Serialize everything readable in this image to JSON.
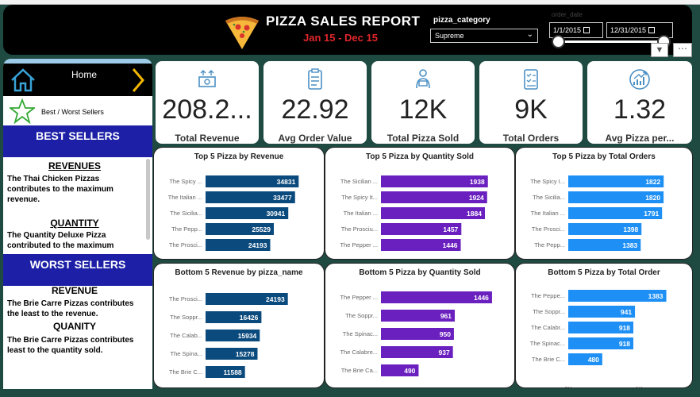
{
  "header": {
    "title": "PIZZA SALES REPORT",
    "subtitle": "Jan 15 - Dec 15",
    "category_filter": {
      "label": "pizza_category",
      "value": "Supreme"
    },
    "date_filter": {
      "label": "order_date",
      "start": "1/1/2015",
      "end": "12/31/2015",
      "range_start_fraction": 0.0,
      "range_end_fraction": 1.0
    }
  },
  "sidebar": {
    "home_label": "Home",
    "nav_label": "Best / Worst Sellers",
    "best_title": "BEST SELLERS",
    "best_revenue_head": "REVENUES",
    "best_revenue_text": "The Thai Chicken Pizzas contributes to the maximum revenue.",
    "best_quantity_head": "QUANTITY",
    "best_quantity_text": "The Quantity Deluxe Pizza contributed to the maximum",
    "worst_title": "WORST SELLERS",
    "worst_revenue_head": "REVENUE",
    "worst_revenue_text": "The Brie Carre Pizzas contributes the least to the revenue.",
    "worst_quantity_head": "QUANITY",
    "worst_quantity_text": "The Brie Carre Pizzas contributes least to the quantity sold."
  },
  "kpis": [
    {
      "label": "Total Revenue",
      "value": "208.2...",
      "icon": "money-icon"
    },
    {
      "label": "Avg Order Value",
      "value": "22.92",
      "icon": "clipboard-icon"
    },
    {
      "label": "Total Pizza Sold",
      "value": "12K",
      "icon": "delivery-icon"
    },
    {
      "label": "Total Orders",
      "value": "9K",
      "icon": "order-list-icon"
    },
    {
      "label": "Avg Pizza per...",
      "value": "1.32",
      "icon": "growth-chart-icon"
    }
  ],
  "colors": {
    "revenue": "#0b4a7d",
    "quantity": "#6a1fbf",
    "orders": "#1e90f5",
    "header_bg": "#000000",
    "accent_red": "#e0262b",
    "section_blue": "#1d20a6",
    "kpi_icon": "#4a8fc4"
  },
  "chart_data": [
    {
      "type": "bar",
      "title": "Top 5 Pizza by Revenue",
      "categories": [
        "The Spicy ...",
        "The Italian ...",
        "The Sicilia...",
        "The Pepp...",
        "The Prosci..."
      ],
      "values": [
        34831,
        33477,
        30941,
        25529,
        24193
      ],
      "value_labels": [
        "34831",
        "33477",
        "30941",
        "25529",
        "24193"
      ],
      "xlim": [
        0,
        38000
      ]
    },
    {
      "type": "bar",
      "title": "Top 5 Pizza by Quantity Sold",
      "categories": [
        "The Sicilian ...",
        "The Spicy It...",
        "The Italian ...",
        "The Prosciu...",
        "The Pepper ..."
      ],
      "values": [
        1938,
        1924,
        1884,
        1457,
        1446
      ],
      "value_labels": [
        "1938",
        "1924",
        "1884",
        "1457",
        "1446"
      ],
      "xlim": [
        0,
        2100
      ]
    },
    {
      "type": "bar",
      "title": "Top 5 Pizza by Total Orders",
      "categories": [
        "The Spicy I...",
        "The Sicilia...",
        "The Italian ...",
        "The Prosci...",
        "The Pepp..."
      ],
      "values": [
        1822,
        1820,
        1791,
        1398,
        1383
      ],
      "value_labels": [
        "1822",
        "1820",
        "1791",
        "1398",
        "1383"
      ],
      "xlim": [
        0,
        2000
      ]
    },
    {
      "type": "bar",
      "title": "Bottom 5 Revenue by pizza_name",
      "categories": [
        "The Prosci...",
        "The Soppr...",
        "The Calab...",
        "The Spina...",
        "The Brie C..."
      ],
      "values": [
        24193,
        16426,
        15934,
        15278,
        11588
      ],
      "value_labels": [
        "24193",
        "16426",
        "15934",
        "15278",
        "11588"
      ],
      "xlim": [
        0,
        28000
      ]
    },
    {
      "type": "bar",
      "title": "Bottom 5 Pizza by Quantity Sold",
      "categories": [
        "The Pepper ...",
        "The Soppr...",
        "The Spinac...",
        "The Calabre...",
        "The Brie Ca..."
      ],
      "values": [
        1446,
        961,
        950,
        937,
        490
      ],
      "value_labels": [
        "1446",
        "961",
        "950",
        "937",
        "490"
      ],
      "xlim": [
        0,
        1550
      ]
    },
    {
      "type": "bar",
      "title": "Bottom 5 Pizza by Total Order",
      "categories": [
        "The Peppe...",
        "The Soppr...",
        "The Calabr...",
        "The Spinac...",
        "The Brie C..."
      ],
      "values": [
        1383,
        941,
        918,
        918,
        480
      ],
      "value_labels": [
        "1383",
        "941",
        "918",
        "918",
        "480"
      ],
      "xlim": [
        0,
        1500
      ],
      "xticks": [
        {
          "value": 0,
          "label": "0K"
        },
        {
          "value": 1000,
          "label": "1K"
        }
      ]
    }
  ]
}
